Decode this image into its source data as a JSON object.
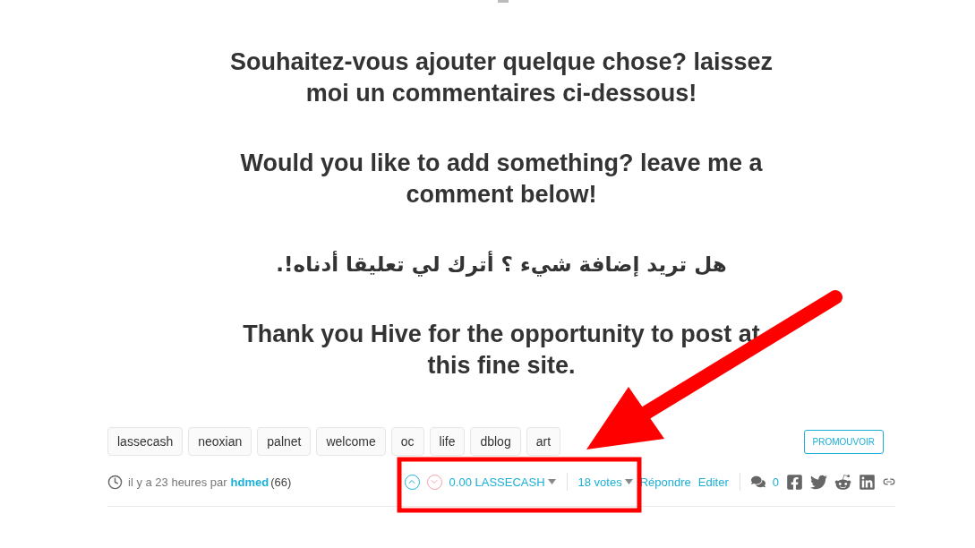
{
  "paragraphs": [
    {
      "text": "Souhaitez-vous ajouter quelque chose? laissez moi un commentaires ci-dessous!",
      "kind": "ltr"
    },
    {
      "text": "Would you like to add something? leave me a comment below!",
      "kind": "ltr"
    },
    {
      "text": "هل تريد إضافة شيء ؟ أترك لي تعليقا أدناه!.",
      "kind": "rtl"
    },
    {
      "text": "Thank you Hive for the opportunity to post at this fine site.",
      "kind": "ltr"
    }
  ],
  "tags": [
    "lassecash",
    "neoxian",
    "palnet",
    "welcome",
    "oc",
    "life",
    "dblog",
    "art"
  ],
  "promote_button": "PROMOUVOIR",
  "meta": {
    "time": "il y a 23 heures par",
    "author": "hdmed",
    "reputation": "(66)"
  },
  "actions": {
    "payout": "0.00 LASSECASH",
    "votes": "18 votes",
    "reply": "Répondre",
    "edit": "Editer",
    "comments": "0"
  }
}
